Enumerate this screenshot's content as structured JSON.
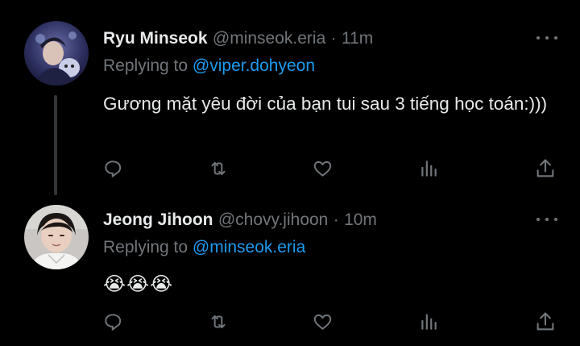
{
  "tweets": [
    {
      "display_name": "Ryu Minseok",
      "handle": "@minseok.eria",
      "separator": "·",
      "time": "11m",
      "replying_prefix": "Replying to ",
      "replying_to": "@viper.dohyeon",
      "text": "Gương mặt yêu đời của bạn tui sau 3 tiếng học toán:)))",
      "avatar_icon": "profile-photo",
      "actions": [
        "reply-icon",
        "retweet-icon",
        "like-icon",
        "views-icon",
        "share-icon"
      ]
    },
    {
      "display_name": "Jeong Jihoon",
      "handle": "@chovy.jihoon",
      "separator": "·",
      "time": "10m",
      "replying_prefix": "Replying to ",
      "replying_to": "@minseok.eria",
      "text": "😭😭😭",
      "avatar_icon": "profile-photo",
      "actions": [
        "reply-icon",
        "retweet-icon",
        "like-icon",
        "views-icon",
        "share-icon"
      ]
    }
  ],
  "colors": {
    "background": "#000000",
    "primary_text": "#e7e9ea",
    "secondary_text": "#71767b",
    "link": "#1d9bf0",
    "thread_line": "#333639"
  }
}
